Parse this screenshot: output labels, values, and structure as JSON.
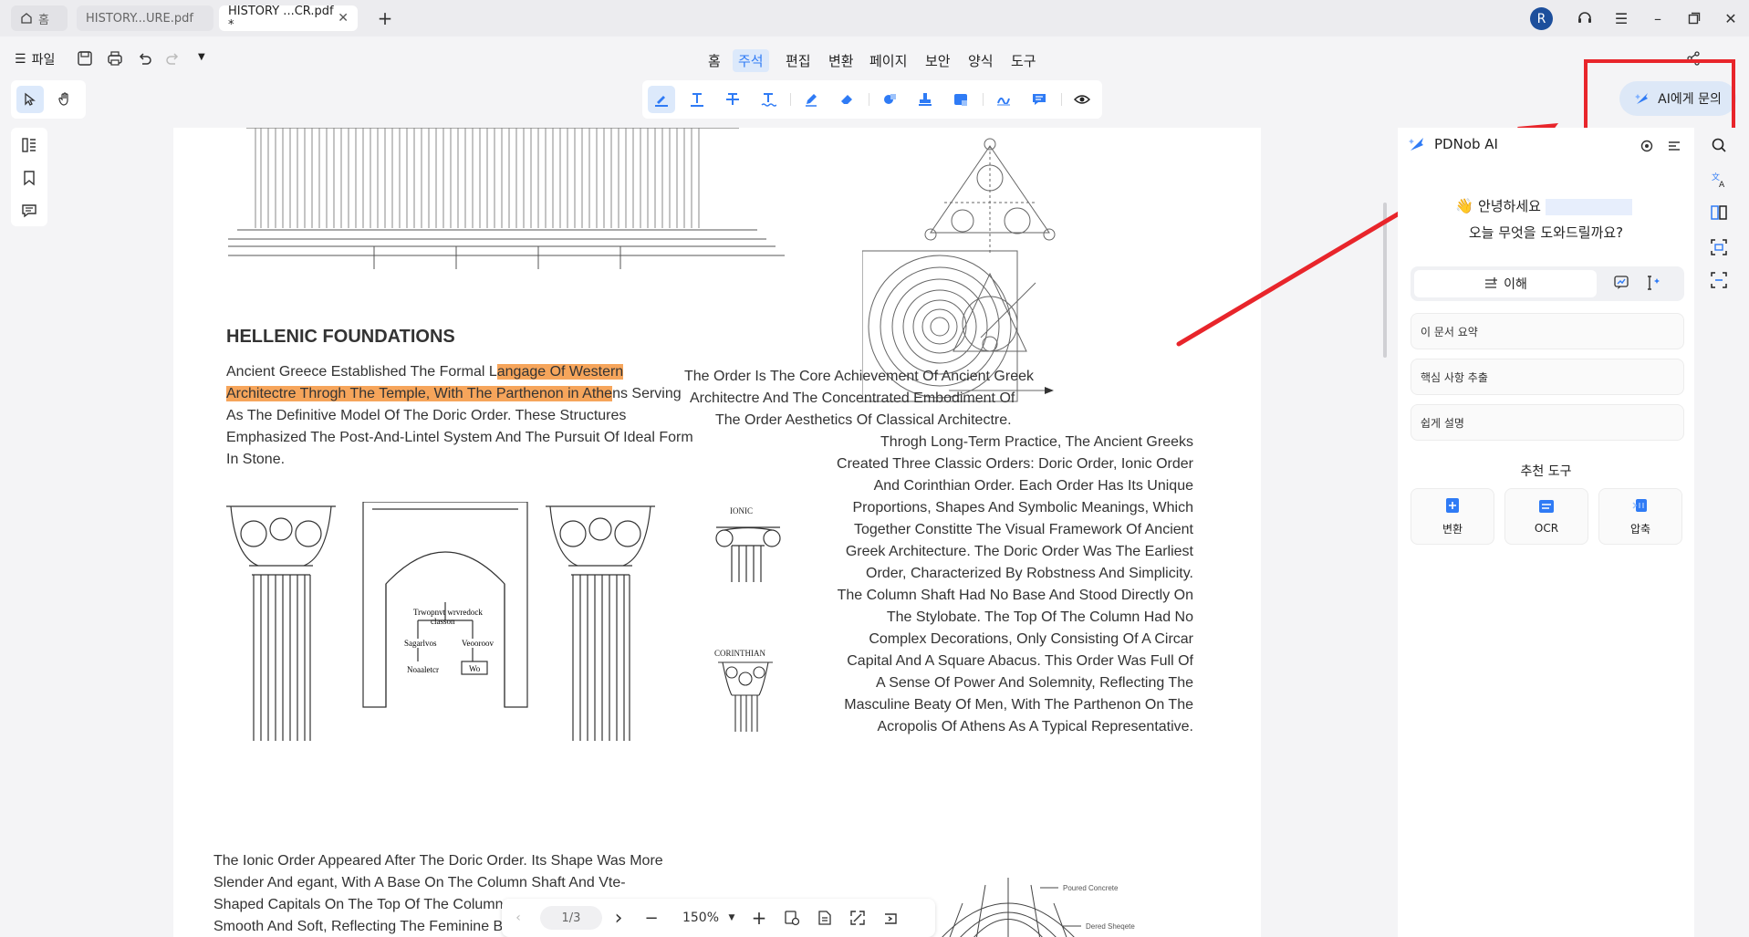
{
  "titlebar": {
    "home_label": "홈",
    "tabs": [
      {
        "label": "HISTORY...URE.pdf"
      },
      {
        "label": "HISTORY ...CR.pdf *"
      }
    ],
    "avatar_initial": "R"
  },
  "menubar": {
    "file_label": "파일",
    "items": [
      "홈",
      "주석",
      "편집",
      "변환",
      "페이지",
      "보안",
      "양식",
      "도구"
    ],
    "active": "주석"
  },
  "document": {
    "section_heading": "HELLENIC FOUNDATIONS",
    "para1_pre": "Ancient Greece Established The Formal L",
    "para1_hl1": "ang​age Of Western",
    "para1_hl2": "Architect​re Thro​gh The Temple, With The Parthenon in Athe",
    "para1_post_hl": "ns Serving",
    "para1_lines": [
      "As The Definitive Model Of The Doric Order. These Structures",
      "Emphasized The Post-And-Lintel System And The Pursuit Of Ideal Form",
      "In Stone."
    ],
    "caption_ionic": "IONIC",
    "caption_corinthian": "CORINTHIAN",
    "arch_lines": [
      "Trwopnvt wrvredock",
      "classon",
      "Sagarlvos",
      "Veooroov",
      "Noaaletcr",
      "Wo"
    ],
    "right_para": [
      "The Order Is The Core Achievement Of Ancient Greek",
      "Architect​re And The Concentrated Embodiment Of",
      "The Order Aesthetics Of Classical Architect​re.",
      "Thro​gh Long-Term Practice, The Ancient Greeks",
      "Created Three Classic Orders: Doric Order, Ionic Order",
      "And Corinthian Order. Each Order Has Its Unique",
      "Proportions, Shapes And Symbolic Meanings, Which",
      "Together Constit​te The Visual Framework Of Ancient",
      "Greek Architecture. The Doric Order Was The Earliest",
      "Order, Characterized By Rob​stness And Simplicity.",
      "The Column Shaft Had No Base And Stood Directly On",
      "The Stylobate. The Top Of The Column Had No",
      "Complex Decorations, Only Consisting Of A Circ​ar",
      "Capital And A Square Abacus. This Order Was Full Of",
      "A Sense Of Power And Solemnity, Reflecting The",
      "Masculine Bea​ty Of Men, With The Parthenon On The",
      "Acropolis Of Athens As A Typical Representative."
    ],
    "bottom_para": [
      "The Ionic Order Appeared After The Doric Order. Its Shape Was More",
      "Slender And ​egant, With A Base On The Column Shaft And V​te-",
      "Shaped Capitals On The Top Of The Column",
      "Smooth And Soft, Reflecting The Feminine B"
    ],
    "dome_label1": "Poured Concrete",
    "dome_label2": "Dered Sheqete"
  },
  "pager": {
    "page": "1/3",
    "zoom": "150%"
  },
  "ai_panel": {
    "title": "PDNob AI",
    "greeting": "안녕하세요",
    "question": "오늘 무엇을 도와드릴까요?",
    "mode_tab": "이해",
    "prompts": [
      "이 문서 요약",
      "핵심 사항 추출",
      "쉽게 설명"
    ],
    "recommended_title": "추천 도구",
    "tools": [
      {
        "label": "변환",
        "color": "#2f7bf5"
      },
      {
        "label": "OCR",
        "color": "#2f7bf5"
      },
      {
        "label": "압축",
        "color": "#2f7bf5"
      }
    ]
  },
  "ask_ai_label": "AI에게 문의",
  "annotation": {
    "color": "#e8252b"
  }
}
